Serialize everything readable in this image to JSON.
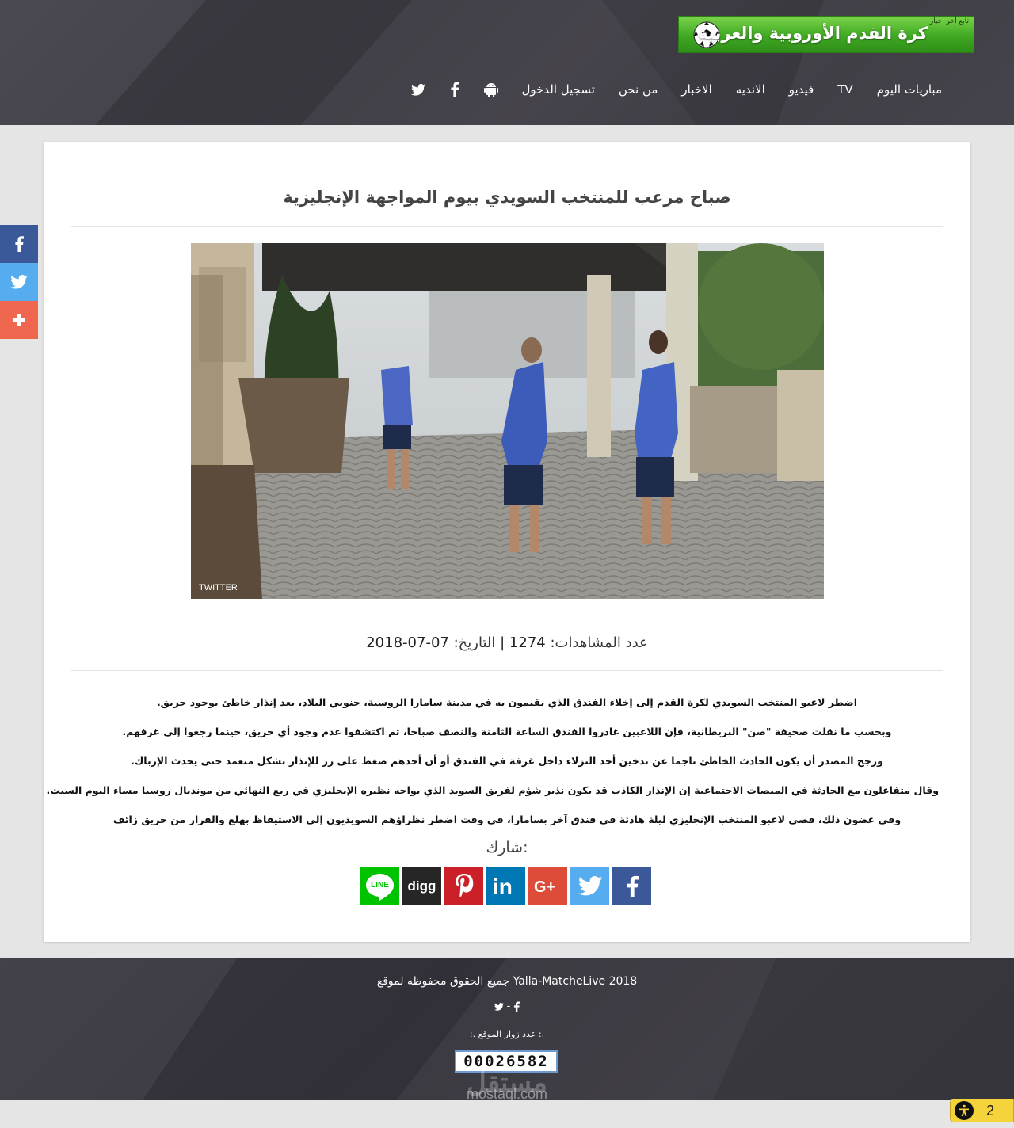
{
  "header": {
    "logo": {
      "title": "كرة القدم الأوروبية والعربية",
      "tagline": "تابع أخر اخبار"
    },
    "nav": [
      {
        "label": "مباريات اليوم"
      },
      {
        "label": "TV"
      },
      {
        "label": "فيديو"
      },
      {
        "label": "الانديه"
      },
      {
        "label": "الاخبار"
      },
      {
        "label": "من نحن"
      },
      {
        "label": "تسجيل الدخول"
      }
    ],
    "nav_icons": [
      "android-icon",
      "facebook-icon",
      "twitter-icon"
    ]
  },
  "side_share": [
    "facebook-icon",
    "twitter-icon",
    "plus-icon"
  ],
  "article": {
    "title": "صباح مرعب للمنتخب السويدي بيوم المواجهة الإنجليزية",
    "photo_credit": "TWITTER",
    "views_label": "عدد المشاهدات:",
    "views": "1274",
    "separator": "|",
    "date_label": "التاريخ:",
    "date": "07-07-2018",
    "paragraphs": [
      "اضطر لاعبو المنتخب السويدي لكرة القدم إلى إخلاء الفندق الذي يقيمون به في مدينة سامارا الروسية، جنوبي البلاد، بعد إنذار خاطئ بوجود حريق.",
      "وبحسب ما نقلت صحيفة \"صن\" البريطانية، فإن اللاعبين غادروا الفندق الساعة الثامنة والنصف صباحا، ثم اكتشفوا عدم وجود أي حريق، حينما رجعوا إلى غرفهم.",
      "ورجح المصدر أن يكون الحادث الخاطئ ناجما عن تدخين أحد النزلاء داخل غرفة في الفندق أو أن أحدهم ضغط على زر للإنذار بشكل متعمد حتى يحدث الإرباك.",
      "وقال متفاعلون مع الحادثة في المنصات الاجتماعية إن الإنذار الكاذب قد يكون نذير شؤم لفريق السويد الذي يواجه نظيره الإنجليزي في ربع النهائي من مونديال روسيا مساء اليوم السبت.",
      "وفي غضون ذلك، قضى لاعبو المنتخب الإنجليزي ليلة هادئة في فندق آخر بسامارا، في وقت اضطر نظراؤهم السويديون إلى الاستيقاظ بهلع والفرار من حريق زائف"
    ],
    "share_label": "شارك:",
    "share_buttons": [
      {
        "name": "facebook",
        "color": "#3b5998"
      },
      {
        "name": "twitter",
        "color": "#55acee"
      },
      {
        "name": "google-plus",
        "color": "#dd4b39"
      },
      {
        "name": "linkedin",
        "color": "#0077b5"
      },
      {
        "name": "pinterest",
        "color": "#cb2027"
      },
      {
        "name": "digg",
        "color": "#262626",
        "label": "digg"
      },
      {
        "name": "line",
        "color": "#00c300",
        "label": "LINE"
      }
    ]
  },
  "footer": {
    "copyright": "جميع الحقوق محفوظه لموقع Yalla-MatcheLive 2018",
    "social_separator": "-",
    "visitors_label": ":. عدد زوار الموقع :.",
    "visitor_count": "00026582",
    "watermark_logo": "مستقل",
    "watermark_url": "mostaql.com"
  },
  "accessibility_badge": {
    "count": "2"
  },
  "colors": {
    "facebook": "#3b5998",
    "twitter": "#55acee",
    "plus": "#f0674f",
    "logo_green": "#3fa822",
    "badge_yellow": "#f5d33a"
  }
}
